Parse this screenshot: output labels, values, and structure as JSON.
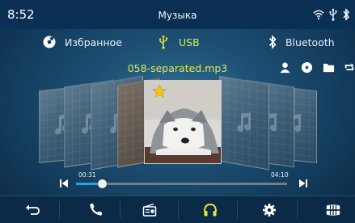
{
  "status": {
    "time": "8:52",
    "title": "Музыка"
  },
  "tabs": [
    {
      "label": "Избранное",
      "icon": "favorites-disc-icon",
      "active": false
    },
    {
      "label": "USB",
      "icon": "usb-icon",
      "active": true
    },
    {
      "label": "Bluetooth",
      "icon": "bluetooth-icon",
      "active": false
    }
  ],
  "track": {
    "filename": "058-separated.mp3"
  },
  "playback": {
    "elapsed": "00:31",
    "total": "04:10",
    "progress_fraction": 0.124
  },
  "colors": {
    "accent_yellow": "#e5e83a",
    "progress_blue": "#2aa3e2",
    "bar_bg": "#0a2a48"
  },
  "bottom_nav": [
    "back-icon",
    "phone-icon",
    "radio-icon",
    "headphones-icon",
    "settings-icon",
    "apps-icon"
  ]
}
